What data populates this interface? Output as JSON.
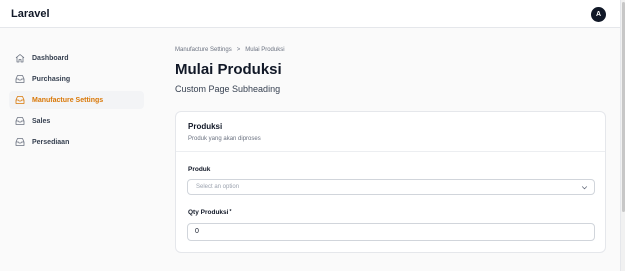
{
  "header": {
    "brand": "Laravel",
    "avatar_initial": "A"
  },
  "sidebar": {
    "items": [
      {
        "label": "Dashboard",
        "icon": "home-icon",
        "active": false
      },
      {
        "label": "Purchasing",
        "icon": "inbox-icon",
        "active": false
      },
      {
        "label": "Manufacture Settings",
        "icon": "inbox-icon",
        "active": true
      },
      {
        "label": "Sales",
        "icon": "inbox-icon",
        "active": false
      },
      {
        "label": "Persediaan",
        "icon": "inbox-icon",
        "active": false
      }
    ]
  },
  "breadcrumb": {
    "parent": "Manufacture Settings",
    "separator": ">",
    "current": "Mulai Produksi"
  },
  "page": {
    "title": "Mulai Produksi",
    "subtitle": "Custom Page Subheading"
  },
  "section": {
    "title": "Produksi",
    "description": "Produk yang akan diproses",
    "fields": {
      "produk": {
        "label": "Produk",
        "placeholder": "Select an option",
        "value": ""
      },
      "qty": {
        "label": "Qty Produksi",
        "required_mark": "*",
        "value": "0"
      }
    }
  },
  "colors": {
    "accent": "#d97706",
    "active_bg": "#f3f4f6",
    "text": "#111827",
    "muted": "#6b7280"
  }
}
